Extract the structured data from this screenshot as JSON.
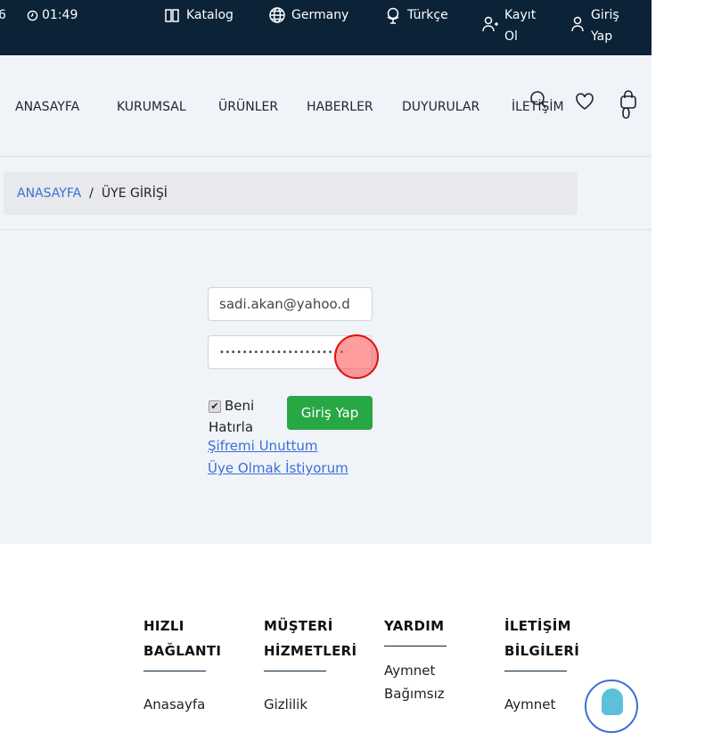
{
  "topbar": {
    "phone_fragment": "6",
    "time": "01:49",
    "katalog": "Katalog",
    "country": "Germany",
    "language": "Türkçe",
    "register": "Kayıt Ol",
    "login": "Giriş Yap"
  },
  "nav": {
    "items": [
      "ANASAYFA",
      "KURUMSAL",
      "ÜRÜNLER",
      "HABERLER",
      "DUYURULAR",
      "İLETİŞİM"
    ],
    "cart_count": "0"
  },
  "breadcrumb": {
    "home": "ANASAYFA",
    "sep": "/",
    "current": "ÜYE GİRİŞİ"
  },
  "login": {
    "email": "sadi.akan@yahoo.d",
    "password": "••••••••••••••••••••••",
    "remember": "Beni Hatırla",
    "submit": "Giriş Yap",
    "forgot": "Şifremi Unuttum",
    "register": "Üye Olmak İstiyorum"
  },
  "footer": {
    "columns": [
      {
        "title": "HIZLI BAĞLANTI",
        "items": [
          "Anasayfa"
        ]
      },
      {
        "title": "MÜŞTERİ HİZMETLERİ",
        "items": [
          "Gizlilik"
        ]
      },
      {
        "title": "YARDIM",
        "items": [
          "Aymnet Bağımsız"
        ]
      },
      {
        "title": "İLETİŞİM BİLGİLERİ",
        "items": [
          "Aymnet"
        ]
      }
    ]
  }
}
